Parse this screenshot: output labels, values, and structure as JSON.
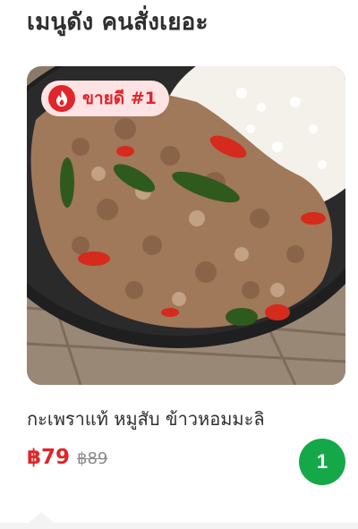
{
  "section": {
    "title": "เมนูดัง คนสั่งเยอะ"
  },
  "product": {
    "badge_icon": "fire-icon",
    "badge_label": "ขายดี #1",
    "name": "กะเพราแท้ หมูสับ ข้าวหอมมะลิ",
    "price": "฿79",
    "old_price": "฿89",
    "quantity": "1"
  },
  "colors": {
    "accent_red": "#e0252b",
    "badge_bg": "#fde3e3",
    "cart_green": "#15a849"
  }
}
